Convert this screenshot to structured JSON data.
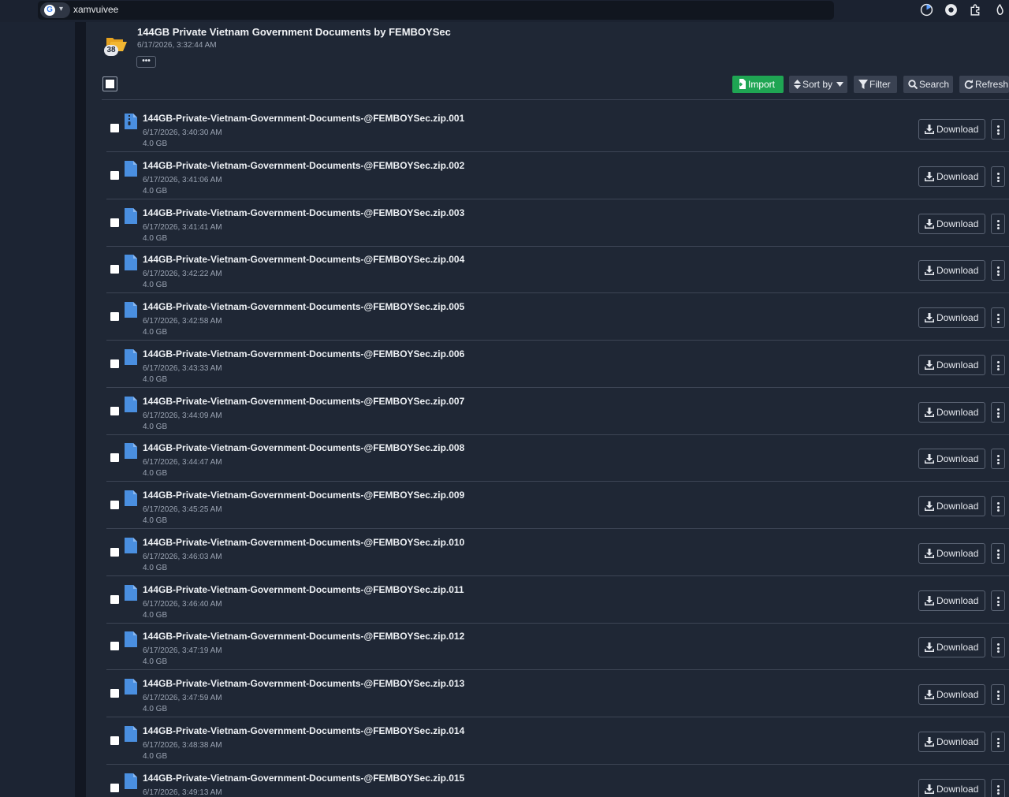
{
  "browser": {
    "address_text": "xamvuivee",
    "google_letter": "G"
  },
  "header": {
    "title": "144GB Private Vietnam Government Documents by FEMBOYSec",
    "date": "6/17/2026, 3:32:44 AM",
    "item_count": "38",
    "more_label": "•••"
  },
  "toolbar": {
    "import_label": "Import",
    "sortby_label": "Sort by",
    "filter_label": "Filter",
    "search_label": "Search",
    "refresh_label": "Refresh"
  },
  "colors": {
    "accent_green": "#1fa553",
    "file_icon_blue": "#4a8fe0",
    "folder_yellow": "#f2b632"
  },
  "files": [
    {
      "name": "144GB-Private-Vietnam-Government-Documents-@FEMBOYSec.zip.001",
      "date": "6/17/2026, 3:40:30 AM",
      "size": "4.0 GB",
      "icon": "zip-file-icon",
      "download_label": "Download"
    },
    {
      "name": "144GB-Private-Vietnam-Government-Documents-@FEMBOYSec.zip.002",
      "date": "6/17/2026, 3:41:06 AM",
      "size": "4.0 GB",
      "icon": "file-icon",
      "download_label": "Download"
    },
    {
      "name": "144GB-Private-Vietnam-Government-Documents-@FEMBOYSec.zip.003",
      "date": "6/17/2026, 3:41:41 AM",
      "size": "4.0 GB",
      "icon": "file-icon",
      "download_label": "Download"
    },
    {
      "name": "144GB-Private-Vietnam-Government-Documents-@FEMBOYSec.zip.004",
      "date": "6/17/2026, 3:42:22 AM",
      "size": "4.0 GB",
      "icon": "file-icon",
      "download_label": "Download"
    },
    {
      "name": "144GB-Private-Vietnam-Government-Documents-@FEMBOYSec.zip.005",
      "date": "6/17/2026, 3:42:58 AM",
      "size": "4.0 GB",
      "icon": "file-icon",
      "download_label": "Download"
    },
    {
      "name": "144GB-Private-Vietnam-Government-Documents-@FEMBOYSec.zip.006",
      "date": "6/17/2026, 3:43:33 AM",
      "size": "4.0 GB",
      "icon": "file-icon",
      "download_label": "Download"
    },
    {
      "name": "144GB-Private-Vietnam-Government-Documents-@FEMBOYSec.zip.007",
      "date": "6/17/2026, 3:44:09 AM",
      "size": "4.0 GB",
      "icon": "file-icon",
      "download_label": "Download"
    },
    {
      "name": "144GB-Private-Vietnam-Government-Documents-@FEMBOYSec.zip.008",
      "date": "6/17/2026, 3:44:47 AM",
      "size": "4.0 GB",
      "icon": "file-icon",
      "download_label": "Download"
    },
    {
      "name": "144GB-Private-Vietnam-Government-Documents-@FEMBOYSec.zip.009",
      "date": "6/17/2026, 3:45:25 AM",
      "size": "4.0 GB",
      "icon": "file-icon",
      "download_label": "Download"
    },
    {
      "name": "144GB-Private-Vietnam-Government-Documents-@FEMBOYSec.zip.010",
      "date": "6/17/2026, 3:46:03 AM",
      "size": "4.0 GB",
      "icon": "file-icon",
      "download_label": "Download"
    },
    {
      "name": "144GB-Private-Vietnam-Government-Documents-@FEMBOYSec.zip.011",
      "date": "6/17/2026, 3:46:40 AM",
      "size": "4.0 GB",
      "icon": "file-icon",
      "download_label": "Download"
    },
    {
      "name": "144GB-Private-Vietnam-Government-Documents-@FEMBOYSec.zip.012",
      "date": "6/17/2026, 3:47:19 AM",
      "size": "4.0 GB",
      "icon": "file-icon",
      "download_label": "Download"
    },
    {
      "name": "144GB-Private-Vietnam-Government-Documents-@FEMBOYSec.zip.013",
      "date": "6/17/2026, 3:47:59 AM",
      "size": "4.0 GB",
      "icon": "file-icon",
      "download_label": "Download"
    },
    {
      "name": "144GB-Private-Vietnam-Government-Documents-@FEMBOYSec.zip.014",
      "date": "6/17/2026, 3:48:38 AM",
      "size": "4.0 GB",
      "icon": "file-icon",
      "download_label": "Download"
    },
    {
      "name": "144GB-Private-Vietnam-Government-Documents-@FEMBOYSec.zip.015",
      "date": "6/17/2026, 3:49:13 AM",
      "size": "",
      "icon": "file-icon",
      "download_label": "Download"
    }
  ]
}
